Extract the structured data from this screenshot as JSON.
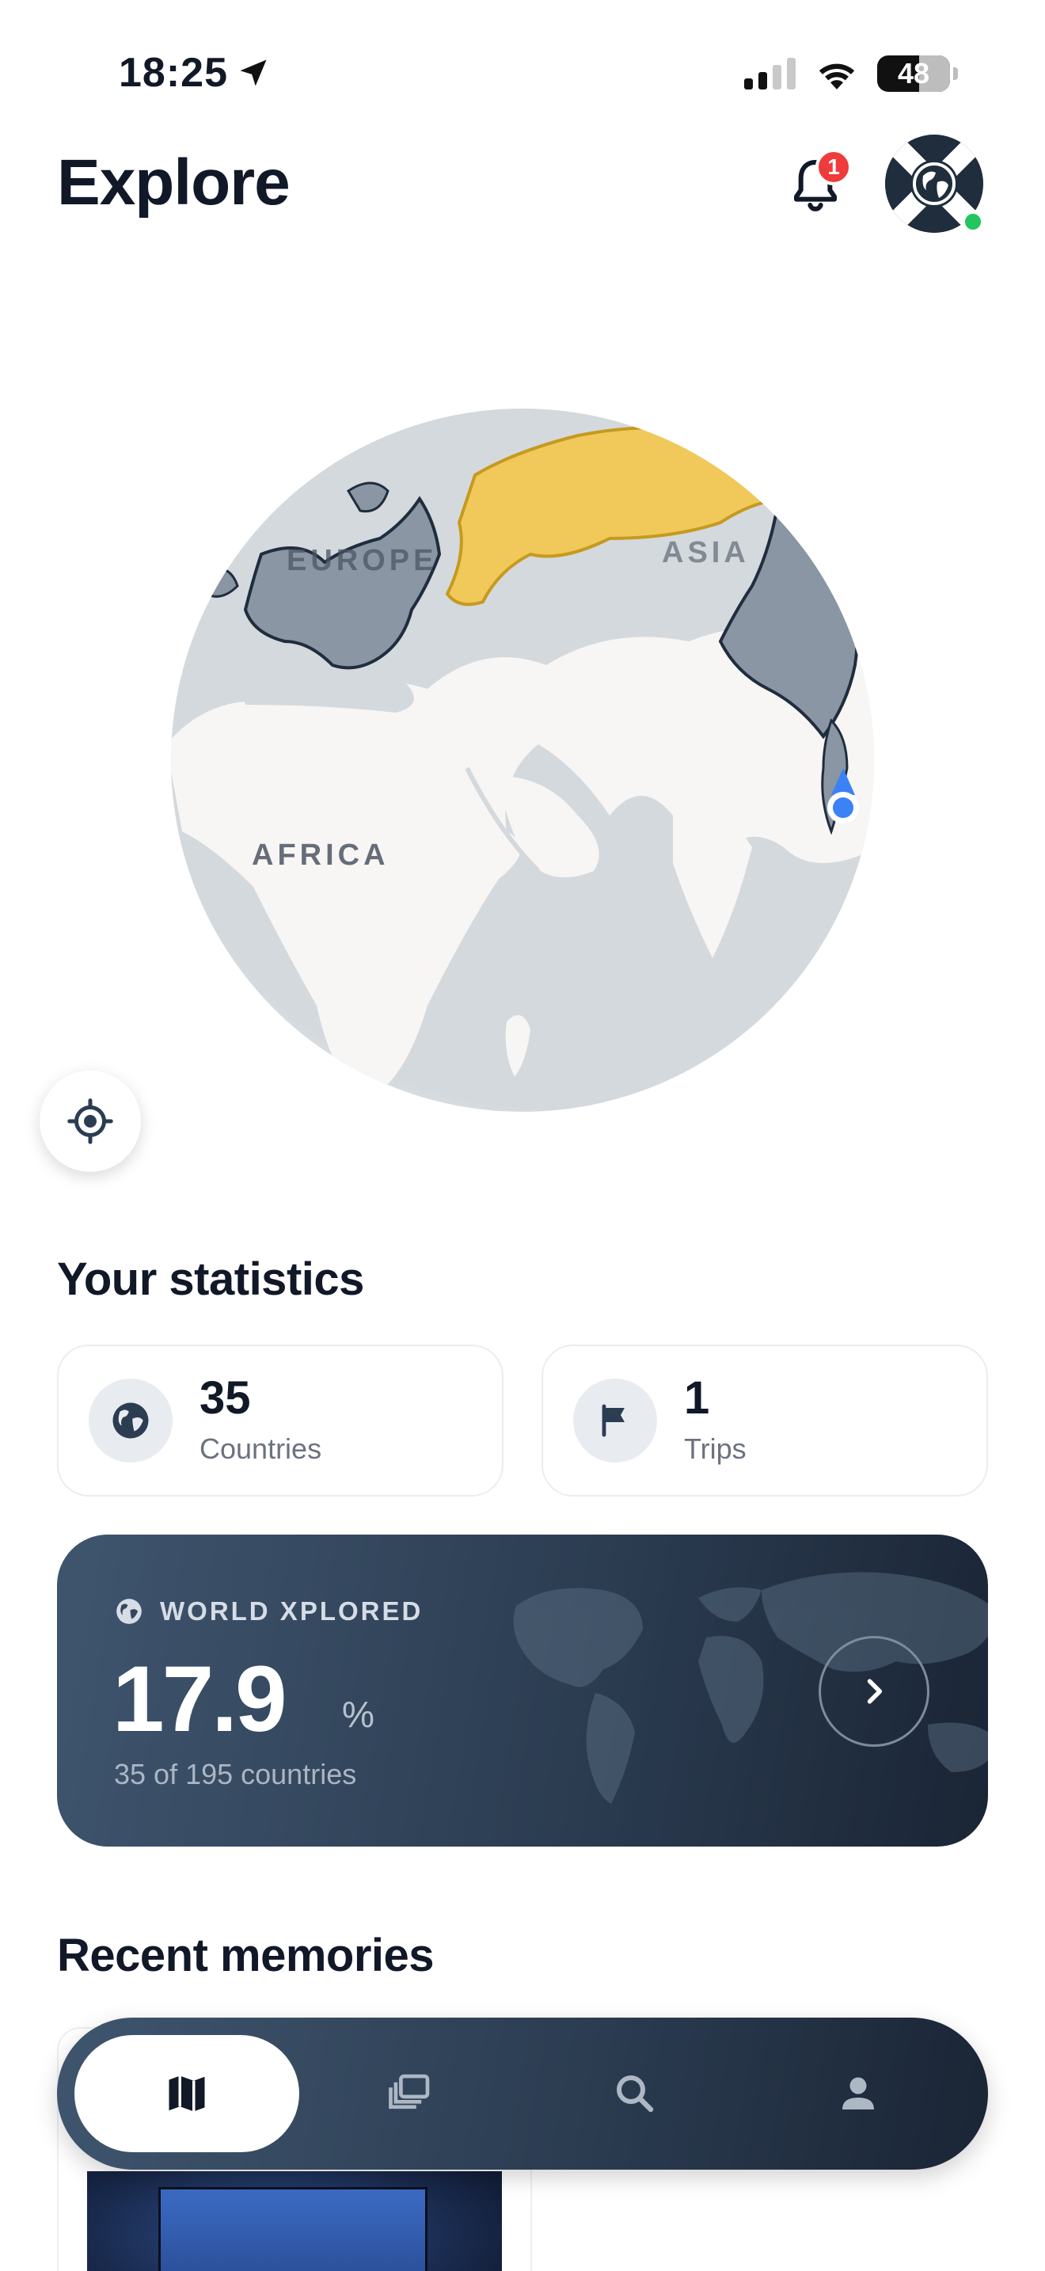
{
  "status_bar": {
    "time": "18:25",
    "battery": "48"
  },
  "header": {
    "title": "Explore",
    "notification_count": "1"
  },
  "globe": {
    "labels": {
      "europe": "EUROPE",
      "asia": "ASIA",
      "africa": "AFRICA"
    },
    "colors": {
      "visited": "#8a96a3",
      "highlight": "#f0c95a",
      "land": "#f7f6f4",
      "ocean": "#d4d9dd",
      "location": "#3b82f6"
    }
  },
  "statistics": {
    "title": "Your statistics",
    "countries": {
      "value": "35",
      "label": "Countries",
      "icon": "globe-icon"
    },
    "trips": {
      "value": "1",
      "label": "Trips",
      "icon": "flag-icon"
    }
  },
  "world_xplored": {
    "label": "WORLD XPLORED",
    "percent": "17.9",
    "unit": "%",
    "subtitle": "35 of 195 countries"
  },
  "memories": {
    "title": "Recent memories"
  },
  "tab_bar": {
    "tabs": [
      {
        "icon": "map-icon",
        "active": true
      },
      {
        "icon": "photos-icon",
        "active": false
      },
      {
        "icon": "search-icon",
        "active": false
      },
      {
        "icon": "person-icon",
        "active": false
      }
    ]
  }
}
